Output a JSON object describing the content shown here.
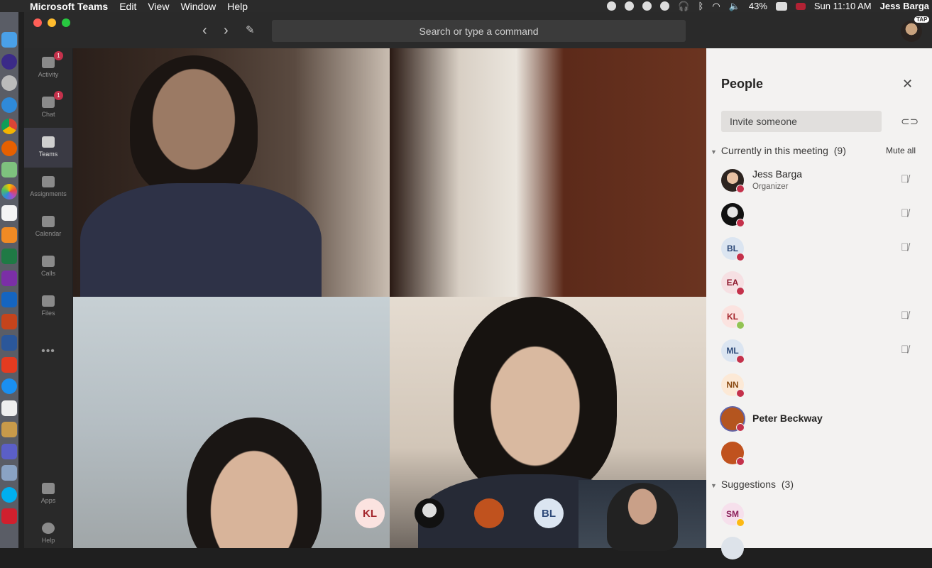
{
  "menubar": {
    "app_name": "Microsoft Teams",
    "menus": [
      "Edit",
      "View",
      "Window",
      "Help"
    ],
    "battery": "43%",
    "clock": "Sun 11:10 AM",
    "user": "Jess Barga"
  },
  "titlebar": {
    "search_placeholder": "Search or type a command",
    "avatar_badge": "TAP"
  },
  "rail": {
    "items": [
      {
        "label": "Activity",
        "badge": "1"
      },
      {
        "label": "Chat",
        "badge": "1"
      },
      {
        "label": "Teams",
        "badge": ""
      },
      {
        "label": "Assignments",
        "badge": ""
      },
      {
        "label": "Calendar",
        "badge": ""
      },
      {
        "label": "Calls",
        "badge": ""
      },
      {
        "label": "Files",
        "badge": ""
      },
      {
        "label": "Apps",
        "badge": ""
      },
      {
        "label": "Help",
        "badge": ""
      }
    ],
    "more": "•••"
  },
  "strip": {
    "avatars": [
      {
        "initials": "KL"
      },
      {
        "initials": ""
      },
      {
        "initials": ""
      },
      {
        "initials": "BL"
      }
    ]
  },
  "people": {
    "title": "People",
    "invite_placeholder": "Invite someone",
    "current_section": "Currently in this meeting",
    "current_count": "(9)",
    "mute_all": "Mute all",
    "participants": [
      {
        "initials": "",
        "name": "Jess Barga",
        "role": "Organizer",
        "status": "busy",
        "mic": true
      },
      {
        "initials": "",
        "name": "",
        "role": "",
        "status": "busy",
        "mic": true
      },
      {
        "initials": "BL",
        "name": "",
        "role": "",
        "status": "busy",
        "mic": true
      },
      {
        "initials": "EA",
        "name": "",
        "role": "",
        "status": "busy",
        "mic": false
      },
      {
        "initials": "KL",
        "name": "",
        "role": "",
        "status": "available",
        "mic": true
      },
      {
        "initials": "ML",
        "name": "",
        "role": "",
        "status": "busy",
        "mic": true
      },
      {
        "initials": "NN",
        "name": "",
        "role": "",
        "status": "busy",
        "mic": false
      },
      {
        "initials": "",
        "name": "Peter Beckway",
        "role": "",
        "status": "busy",
        "mic": false
      },
      {
        "initials": "",
        "name": "",
        "role": "",
        "status": "busy",
        "mic": false
      }
    ],
    "suggestions_section": "Suggestions",
    "suggestions_count": "(3)",
    "suggestions": [
      {
        "initials": "SM",
        "status": "away"
      }
    ]
  },
  "colors": {
    "accent": "#6264a7",
    "busy": "#c4314b",
    "available": "#92c353",
    "away": "#fdb913"
  }
}
